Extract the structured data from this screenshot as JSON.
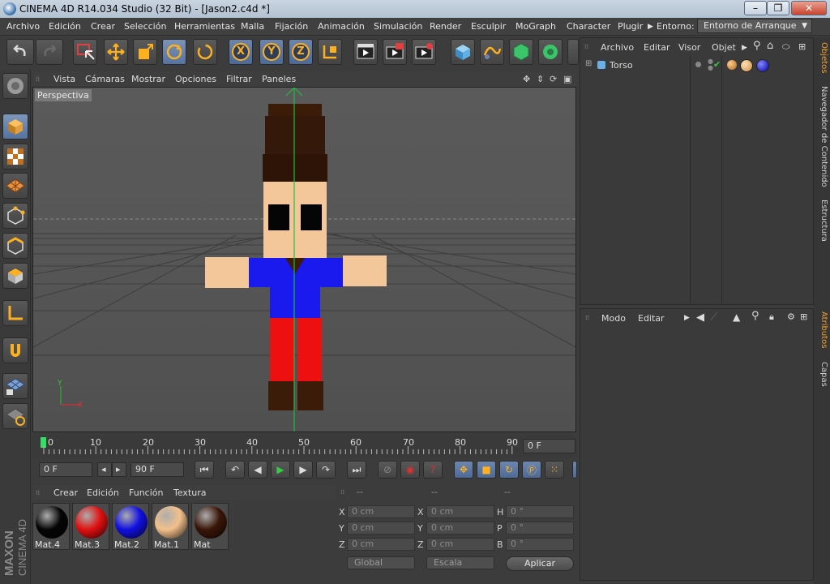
{
  "window": {
    "title": "CINEMA 4D R14.034 Studio (32 Bit) - [Jason2.c4d *]",
    "min": "–",
    "max": "❐",
    "close": "✕"
  },
  "menu": [
    "Archivo",
    "Edición",
    "Crear",
    "Selección",
    "Herramientas",
    "Malla",
    "Fijación",
    "Animación",
    "Simulación",
    "Render",
    "Esculpir",
    "MoGraph",
    "Character",
    "Plugir"
  ],
  "env_label": "Entorno:",
  "env_value": "Entorno de Arranque",
  "viewport": {
    "menu": [
      "Vista",
      "Cámaras",
      "Mostrar",
      "Opciones",
      "Filtrar",
      "Paneles"
    ],
    "label": "Perspectiva",
    "axis_y": "Y",
    "axis_x": "X"
  },
  "timeline": {
    "ticks": [
      "0",
      "10",
      "20",
      "30",
      "40",
      "50",
      "60",
      "70",
      "80",
      "90"
    ],
    "end_field": "0 F"
  },
  "anim": {
    "current": "0 F",
    "end": "90 F",
    "prev": "◂",
    "next": "▸"
  },
  "materials": {
    "menu": [
      "Crear",
      "Edición",
      "Función",
      "Textura"
    ],
    "items": [
      {
        "name": "Mat.4",
        "color": "#050505"
      },
      {
        "name": "Mat.3",
        "color": "#e01010"
      },
      {
        "name": "Mat.2",
        "color": "#1010e0"
      },
      {
        "name": "Mat.1",
        "color": "#f2c08a"
      },
      {
        "name": "Mat",
        "color": "#3a1608"
      }
    ]
  },
  "coords": {
    "headers": [
      "--",
      "--",
      "--"
    ],
    "rows": [
      {
        "l1": "X",
        "v1": "0 cm",
        "l2": "X",
        "v2": "0 cm",
        "l3": "H",
        "v3": "0 °"
      },
      {
        "l1": "Y",
        "v1": "0 cm",
        "l2": "Y",
        "v2": "0 cm",
        "l3": "P",
        "v3": "0 °"
      },
      {
        "l1": "Z",
        "v1": "0 cm",
        "l2": "Z",
        "v2": "0 cm",
        "l3": "B",
        "v3": "0 °"
      }
    ],
    "global": "Global",
    "scale": "Escala",
    "apply": "Aplicar"
  },
  "objects": {
    "menu": [
      "Archivo",
      "Editar",
      "Visor",
      "Objet"
    ],
    "tree": [
      {
        "name": "Torso"
      }
    ]
  },
  "attributes": {
    "menu": [
      "Modo",
      "Editar"
    ]
  },
  "right_tabs": [
    "Objetos",
    "Navegador de Contenido",
    "Estructura",
    "Atributos",
    "Capas"
  ],
  "brand": {
    "maxon": "MAXON",
    "product": "CINEMA 4D"
  },
  "colors": {
    "accent": "#f0a030",
    "active_tool": "#6b85ad"
  }
}
